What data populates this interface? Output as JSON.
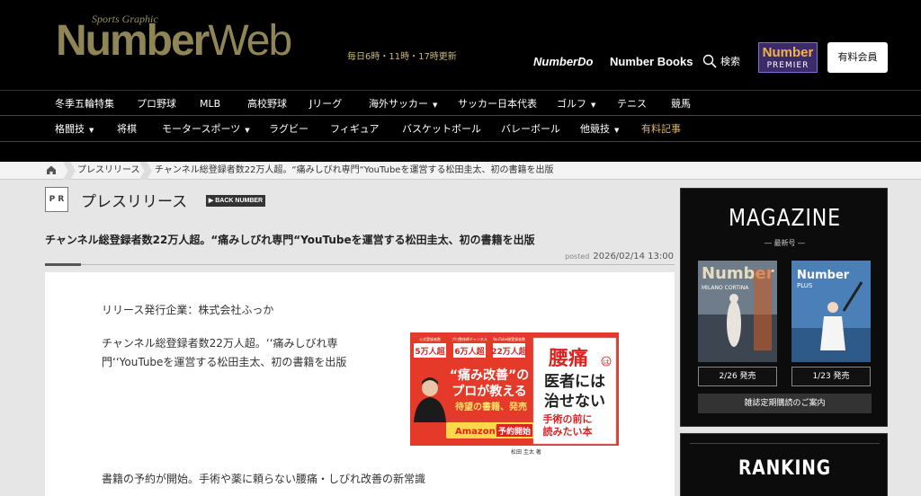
{
  "header": {
    "logo_small": "Sports Graphic",
    "logo_main": "Number",
    "logo_web": "Web",
    "update_text": "毎日6時・11時・17時更新",
    "number_do": "NumberDo",
    "number_books": "Number Books",
    "search_label": "検索",
    "premier_top": "Number",
    "premier_bottom": "PREMIER",
    "member_button": "有料会員"
  },
  "nav": {
    "row1": [
      {
        "label": "冬季五輪特集",
        "caret": false
      },
      {
        "label": "プロ野球",
        "caret": false
      },
      {
        "label": "MLB",
        "caret": false
      },
      {
        "label": "高校野球",
        "caret": false
      },
      {
        "label": "Jリーグ",
        "caret": false
      },
      {
        "label": "海外サッカー",
        "caret": true
      },
      {
        "label": "サッカー日本代表",
        "caret": false
      },
      {
        "label": "ゴルフ",
        "caret": true
      },
      {
        "label": "テニス",
        "caret": false
      },
      {
        "label": "競馬",
        "caret": false
      }
    ],
    "row2": [
      {
        "label": "格闘技",
        "caret": true
      },
      {
        "label": "将棋",
        "caret": false
      },
      {
        "label": "モータースポーツ",
        "caret": true
      },
      {
        "label": "ラグビー",
        "caret": false
      },
      {
        "label": "フィギュア",
        "caret": false
      },
      {
        "label": "バスケットボール",
        "caret": false
      },
      {
        "label": "バレーボール",
        "caret": false
      },
      {
        "label": "他競技",
        "caret": true
      },
      {
        "label": "有料記事",
        "caret": false
      }
    ]
  },
  "breadcrumb": {
    "level1": "プレスリリース",
    "current": "チャンネル総登録者数22万人超。“痛みしびれ専門“YouTubeを運営する松田圭太、初の書籍を出版"
  },
  "section": {
    "icon_text": "P R",
    "title": "プレスリリース",
    "back_label": "▶ BACK NUMBER"
  },
  "article": {
    "headline": "チャンネル総登録者数22万人超。“痛みしびれ専門“YouTubeを運営する松田圭太、初の書籍を出版",
    "posted_label": "posted",
    "posted_date": "2026/02/14 13:00",
    "company_line": "リリース発行企業：株式会社ふっか",
    "lead": "チャンネル総登録者数22万人超。‘‘痛みしびれ専門‘‘YouTubeを運営する松田圭太、初の書籍を出版",
    "body_start": "書籍の予約が開始。手術や薬に頼らない腰痛・しびれ改善の新常識"
  },
  "book_image": {
    "stat1_label": "公式登録者数",
    "stat1_value": "5万人超",
    "stat2_label": "プロ整体師チャンネル",
    "stat2_value": "6万人超",
    "stat3_label": "YouTube総登録者数",
    "stat3_value": "22万人超",
    "quote_line1": "“痛み改善”の",
    "quote_line2": "プロが教える",
    "tagline": "待望の書籍、発売",
    "amazon_prefix": "Amazonで",
    "amazon_suffix": "予約開始",
    "author": "松田 圭太 著",
    "cover_title1": "腰痛",
    "cover_title2": "は",
    "cover_title3": "医者には",
    "cover_title4": "治せない",
    "cover_sub1": "手術の前に",
    "cover_sub2": "読みたい本"
  },
  "magazine": {
    "title": "MAGAZINE",
    "subtitle": "― 最新号 ―",
    "cover1_brand": "Number",
    "cover1_text": "MILANO CORTINA",
    "cover2_brand": "Number",
    "cover2_text": "PLUS",
    "date1": "2/26 発売",
    "date2": "1/23 発売",
    "subscribe": "雑誌定期購読のご案内"
  },
  "ranking": {
    "title": "RANKING"
  },
  "colors": {
    "gold": "#8f8557",
    "accent_red": "#e03a2f",
    "nav_bg": "#000000"
  }
}
